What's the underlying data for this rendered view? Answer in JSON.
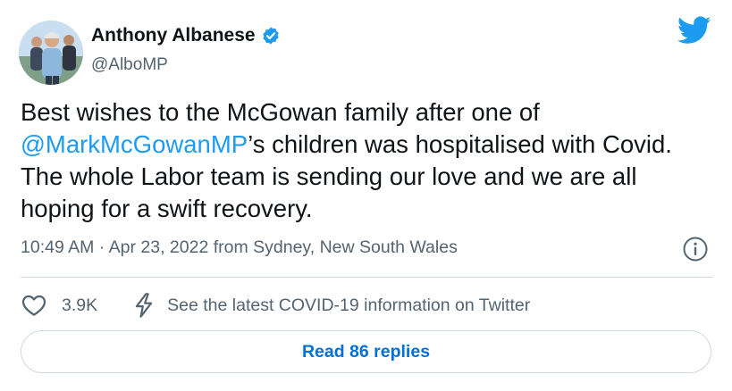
{
  "author": {
    "name": "Anthony Albanese",
    "handle": "@AlboMP",
    "verified": true
  },
  "tweet": {
    "text_before": "Best wishes to the McGowan family after one of ",
    "mention": "@MarkMcGowanMP",
    "text_after": "’s children was hospitalised with Covid. The whole Labor team is sending our love and we are all hoping for a swift recovery."
  },
  "meta": {
    "timestamp": "10:49 AM · Apr 23, 2022 from Sydney, New South Wales"
  },
  "actions": {
    "likes": "3.9K",
    "covid_notice": "See the latest COVID-19 information on Twitter"
  },
  "replies_button": {
    "label": "Read 86 replies"
  },
  "colors": {
    "accent": "#1d9bf0",
    "link_button": "#006fd6",
    "secondary_text": "#536471",
    "border": "#cfd9de"
  },
  "icons": [
    "verified-badge-icon",
    "twitter-bird-icon",
    "info-icon",
    "heart-icon",
    "lightning-bolt-icon"
  ]
}
